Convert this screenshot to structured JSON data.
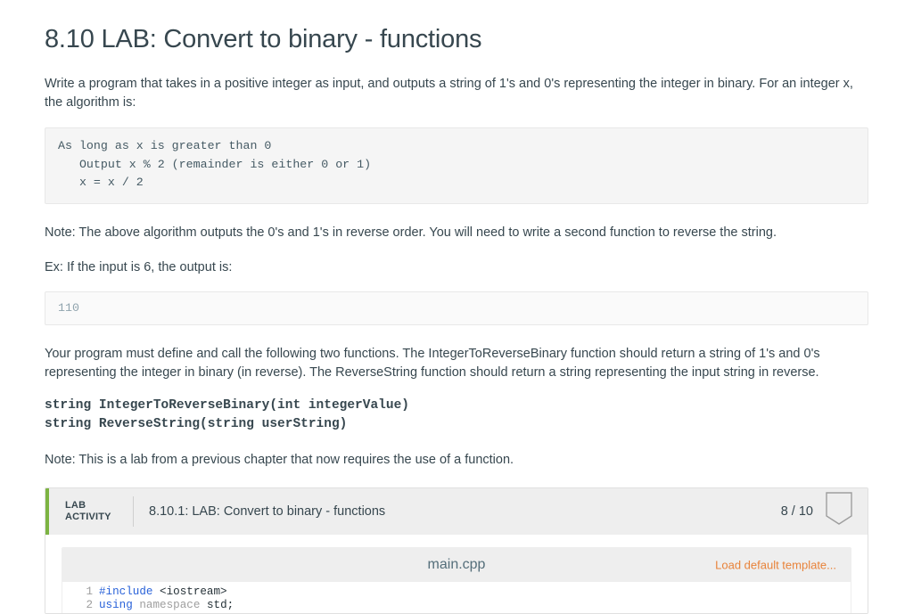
{
  "page": {
    "title": "8.10 LAB: Convert to binary - functions",
    "intro": "Write a program that takes in a positive integer as input, and outputs a string of 1's and 0's representing the integer in binary. For an integer x, the algorithm is:",
    "algorithm": "As long as x is greater than 0\n   Output x % 2 (remainder is either 0 or 1)\n   x = x / 2",
    "note_reverse": "Note: The above algorithm outputs the 0's and 1's in reverse order. You will need to write a second function to reverse the string.",
    "example_label": "Ex: If the input is 6, the output is:",
    "example_output": "110",
    "functions_desc": "Your program must define and call the following two functions. The IntegerToReverseBinary function should return a string of 1's and 0's representing the integer in binary (in reverse). The ReverseString function should return a string representing the input string in reverse.",
    "signatures": "string IntegerToReverseBinary(int integerValue)\nstring ReverseString(string userString)",
    "note_prev_chapter": "Note: This is a lab from a previous chapter that now requires the use of a function."
  },
  "lab_activity": {
    "label": "LAB\nACTIVITY",
    "name": "8.10.1: LAB: Convert to binary - functions",
    "score": "8 / 10",
    "accent_color": "#7cb342",
    "shield_icon": "shield-outline-icon"
  },
  "editor": {
    "filename": "main.cpp",
    "load_default_template": "Load default template...",
    "link_color": "#e8833a",
    "lines": [
      {
        "number": "1",
        "tokens": [
          {
            "text": "#include",
            "type": "pre"
          },
          {
            "text": " ",
            "type": "txt"
          },
          {
            "text": "<iostream>",
            "type": "txt"
          }
        ]
      },
      {
        "number": "2",
        "tokens": [
          {
            "text": "using",
            "type": "kw"
          },
          {
            "text": " ",
            "type": "txt"
          },
          {
            "text": "namespace",
            "type": "dim"
          },
          {
            "text": " ",
            "type": "txt"
          },
          {
            "text": "std;",
            "type": "txt"
          }
        ]
      }
    ]
  }
}
